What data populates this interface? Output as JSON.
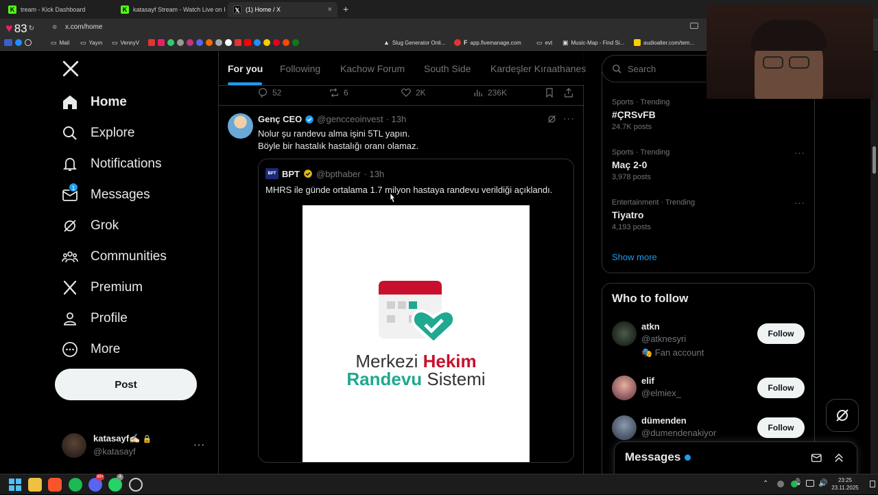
{
  "overlay": {
    "heart_count": "83"
  },
  "browser": {
    "tabs": [
      {
        "label": "tream - Kick Dashboard",
        "active": false
      },
      {
        "label": "katasayf Stream - Watch Live on Kick",
        "active": false
      },
      {
        "label": "(1) Home / X",
        "active": true
      }
    ],
    "new_tab": "+",
    "url": "x.com/home",
    "bookmarks": [
      {
        "label": "Mail"
      },
      {
        "label": "Yayın"
      },
      {
        "label": "VennyV"
      },
      {
        "label": "Slug Generator Onli..."
      },
      {
        "label": "app.fivemanage.com"
      },
      {
        "label": "evt"
      },
      {
        "label": "Music-Map - Find Si..."
      },
      {
        "label": "audioalter.com/tem..."
      }
    ]
  },
  "sidebar": {
    "items": [
      {
        "label": "Home",
        "icon": "home-icon"
      },
      {
        "label": "Explore",
        "icon": "search-icon"
      },
      {
        "label": "Notifications",
        "icon": "bell-icon"
      },
      {
        "label": "Messages",
        "icon": "mail-icon",
        "badge": "1"
      },
      {
        "label": "Grok",
        "icon": "grok-icon"
      },
      {
        "label": "Communities",
        "icon": "communities-icon"
      },
      {
        "label": "Premium",
        "icon": "x-icon"
      },
      {
        "label": "Profile",
        "icon": "person-icon"
      },
      {
        "label": "More",
        "icon": "more-icon"
      }
    ],
    "post_label": "Post",
    "account": {
      "name": "katasayf✍🏻",
      "handle": "@katasayf"
    }
  },
  "feed": {
    "tabs": [
      "For you",
      "Following",
      "Kachow Forum",
      "South Side",
      "Kardeşler Kıraathanes"
    ],
    "prev_actions": {
      "replies": "52",
      "reposts": "6",
      "likes": "2K",
      "views": "236K"
    },
    "tweet": {
      "author": "Genç CEO",
      "handle": "@gencceoinvest",
      "time": "· 13h",
      "text_line1": "Nolur şu randevu alma işini 5TL yapın.",
      "text_line2": "Böyle bir hastalık hastalığı oranı olamaz.",
      "quote": {
        "avatar_text": "BPT",
        "author": "BPT",
        "handle": "@bpthaber",
        "time": "· 13h",
        "text": "MHRS ile günde ortalama 1.7 milyon hastaya randevu verildiği açıklandı.",
        "image_line1_a": "Merkezi ",
        "image_line1_b": "Hekim",
        "image_line2_a": "Randevu",
        "image_line2_b": " Sistemi"
      }
    }
  },
  "right": {
    "search_placeholder": "Search",
    "trends": [
      {
        "category": "Sports · Trending",
        "name": "#ÇRSvFB",
        "count": "24.7K posts"
      },
      {
        "category": "Sports · Trending",
        "name": "Maç 2-0",
        "count": "3,978 posts"
      },
      {
        "category": "Entertainment · Trending",
        "name": "Tiyatro",
        "count": "4,193 posts"
      }
    ],
    "show_more": "Show more",
    "who_to_follow_title": "Who to follow",
    "who_to_follow": [
      {
        "name": "atkn",
        "handle": "@atknesyri",
        "note": "🎭 Fan account",
        "button": "Follow"
      },
      {
        "name": "elif",
        "handle": "@elmiex_",
        "button": "Follow"
      },
      {
        "name": "dümenden",
        "handle": "@dumendenakiyor",
        "button": "Follow"
      }
    ],
    "messages_drawer": "Messages"
  },
  "taskbar": {
    "time": "23:25",
    "date": "23.11.2025",
    "discord_badge": "99+",
    "whatsapp_badge": "4"
  },
  "colors": {
    "accent": "#1d9bf0",
    "verified_gold": "#e2b719",
    "like_red": "#f91880"
  }
}
